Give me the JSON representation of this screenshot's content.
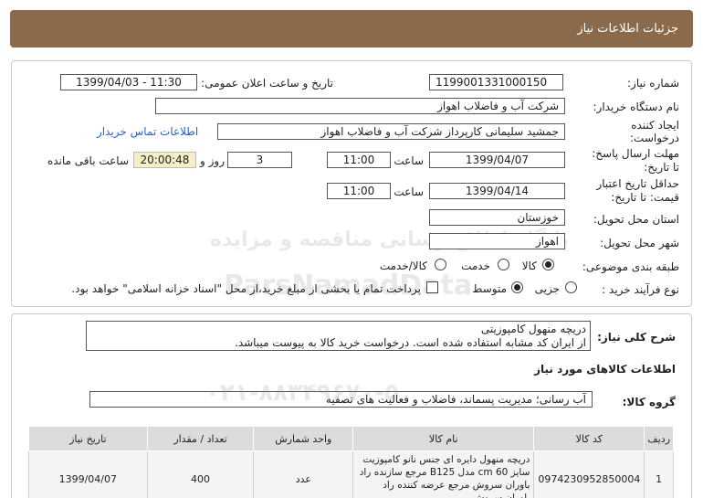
{
  "header": {
    "title": "جزئیات اطلاعات نیاز"
  },
  "form": {
    "need_number_label": "شماره نیاز:",
    "need_number": "1199001331000150",
    "announce_label": "تاریخ و ساعت اعلان عمومی:",
    "announce_value": "1399/04/03 - 11:30",
    "buyer_label": "نام دستگاه خریدار:",
    "buyer_value": "شرکت آب و فاضلاب اهواز",
    "creator_label_1": "ایجاد کننده",
    "creator_label_2": "درخواست:",
    "creator_value": "جمشید سلیمانی کارپرداز شرکت آب و فاضلاب اهواز",
    "contact_link": "اطلاعات تماس خریدار",
    "deadline_label_1": "مهلت ارسال پاسخ:",
    "deadline_label_2": "تا تاریخ:",
    "deadline_date": "1399/04/07",
    "time_label": "ساعت",
    "deadline_time": "11:00",
    "days_value": "3",
    "days_label": "روز و",
    "remaining_time": "20:00:48",
    "remaining_label": "ساعت باقی مانده",
    "validity_label_1": "حداقل تاریخ اعتبار",
    "validity_label_2": "قیمت: تا تاریخ:",
    "validity_date": "1399/04/14",
    "validity_time": "11:00",
    "province_label": "استان محل تحویل:",
    "province_value": "خوزستان",
    "city_label": "شهر محل تحویل:",
    "city_value": "اهواز",
    "category_label": "طبقه بندی موضوعی:",
    "category_options": [
      "کالا",
      "خدمت",
      "کالا/خدمت"
    ],
    "category_selected": "کالا",
    "process_label": "نوع فرآیند خرید :",
    "process_options": [
      "جزیی",
      "متوسط"
    ],
    "process_selected": "متوسط",
    "payment_note": "پرداخت تمام یا بخشی از مبلغ خرید،از محل \"اسناد خزانه اسلامی\" خواهد بود."
  },
  "description": {
    "label": "شرح کلی نیاز:",
    "line1": "دریچه منهول کامپوزیتی",
    "line2": "از ایران کد مشابه استفاده شده است. درخواست خرید کالا به پیوست میباشد."
  },
  "goods": {
    "section_title": "اطلاعات کالاهای مورد نیاز",
    "group_label": "گروه کالا:",
    "group_value": "آب رسانی؛ مدیریت پسماند، فاضلاب و فعالیت های تصفیه",
    "columns": [
      "ردیف",
      "کد کالا",
      "نام کالا",
      "واحد شمارش",
      "تعداد / مقدار",
      "تاریخ نیاز"
    ],
    "rows": [
      {
        "index": "1",
        "code": "0974230952850004",
        "name": "دریچه منهول دایره ای جنس نانو کامپوزیت سایز cm 60 مدل B125 مرجع سازنده راد باوران سروش مرجع عرضه کننده راد باوران سروش",
        "unit": "عدد",
        "qty": "400",
        "date": "1399/04/07"
      }
    ]
  },
  "watermark": {
    "line1": "ParsNamadData",
    "line2": "پایگاه اطلاع رسانی مناقصه و مزایده",
    "line3": "۰۲۱-۸۸۳۴۹۶۷۰-۵"
  }
}
